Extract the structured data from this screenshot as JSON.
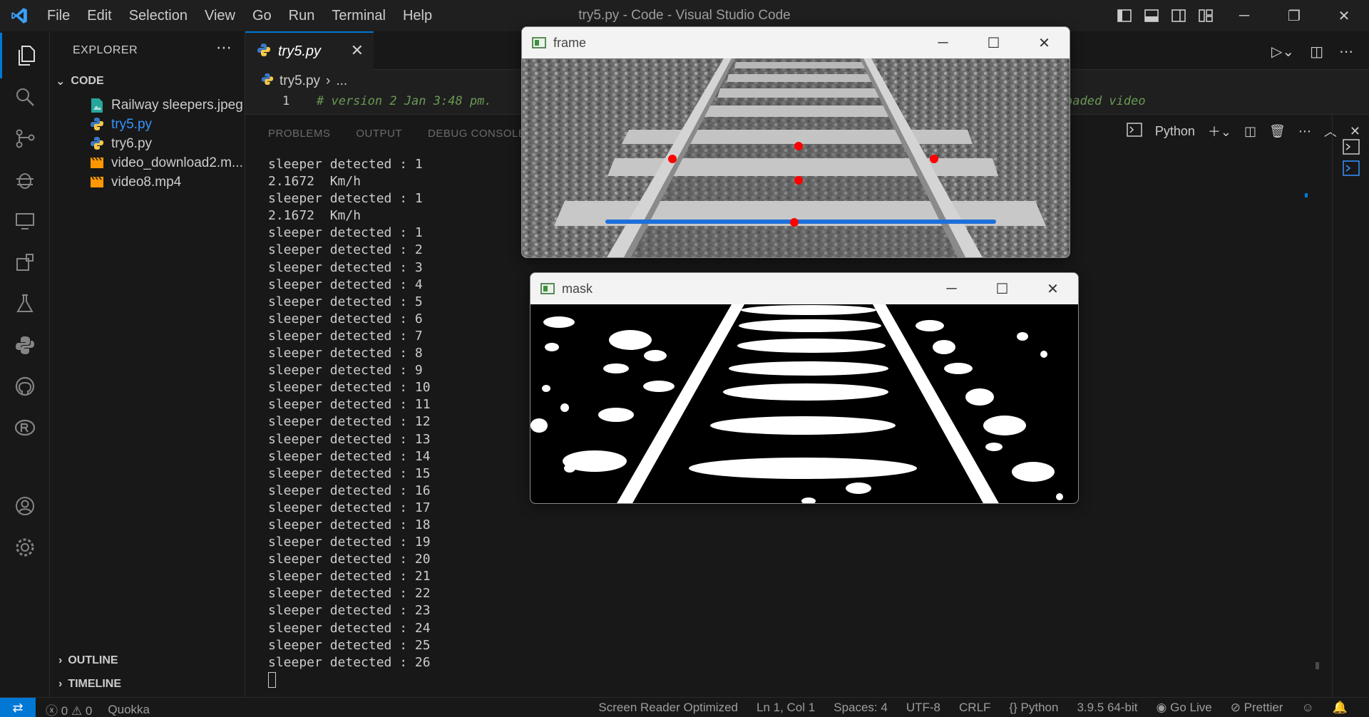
{
  "window": {
    "title": "try5.py - Code - Visual Studio Code"
  },
  "menu": [
    "File",
    "Edit",
    "Selection",
    "View",
    "Go",
    "Run",
    "Terminal",
    "Help"
  ],
  "sidebar": {
    "header": "EXPLORER",
    "section": "CODE",
    "files": [
      {
        "name": "Railway sleepers.jpeg",
        "icon": "image-file-icon"
      },
      {
        "name": "try5.py",
        "icon": "python-file-icon"
      },
      {
        "name": "try6.py",
        "icon": "python-file-icon"
      },
      {
        "name": "video_download2.m...",
        "icon": "video-file-icon"
      },
      {
        "name": "video8.mp4",
        "icon": "video-file-icon"
      }
    ],
    "outline": "OUTLINE",
    "timeline": "TIMELINE"
  },
  "editor": {
    "tab_label": "try5.py",
    "breadcrumb_file": "try5.py",
    "breadcrumb_more": "...",
    "line_number": "1",
    "line_text": "# version 2 Jan 3:48 pm.",
    "line_text_tail": "oaded video"
  },
  "panel": {
    "tabs": [
      "PROBLEMS",
      "OUTPUT",
      "DEBUG CONSOLE"
    ],
    "terminal_label": "Python",
    "lines": [
      "sleeper detected : 1",
      "2.1672  Km/h",
      "sleeper detected : 1",
      "2.1672  Km/h",
      "sleeper detected : 1",
      "sleeper detected : 2",
      "sleeper detected : 3",
      "sleeper detected : 4",
      "sleeper detected : 5",
      "sleeper detected : 6",
      "sleeper detected : 7",
      "sleeper detected : 8",
      "sleeper detected : 9",
      "sleeper detected : 10",
      "sleeper detected : 11",
      "sleeper detected : 12",
      "sleeper detected : 13",
      "sleeper detected : 14",
      "sleeper detected : 15",
      "sleeper detected : 16",
      "sleeper detected : 17",
      "sleeper detected : 18",
      "sleeper detected : 19",
      "sleeper detected : 20",
      "sleeper detected : 21",
      "sleeper detected : 22",
      "sleeper detected : 23",
      "sleeper detected : 24",
      "sleeper detected : 25",
      "sleeper detected : 26"
    ]
  },
  "statusbar": {
    "errors": "0",
    "warnings": "0",
    "quokka": "Quokka",
    "screen_reader": "Screen Reader Optimized",
    "position": "Ln 1, Col 1",
    "spaces": "Spaces: 4",
    "encoding": "UTF-8",
    "eol": "CRLF",
    "language": "Python",
    "interpreter": "3.9.5 64-bit",
    "go_live": "Go Live",
    "prettier": "Prettier"
  },
  "frame_window": {
    "title": "frame"
  },
  "mask_window": {
    "title": "mask"
  },
  "colors": {
    "accent": "#0078d4",
    "active_file": "#3794ff",
    "detection_point": "#ff0000",
    "detection_line": "#1e6fd9"
  }
}
